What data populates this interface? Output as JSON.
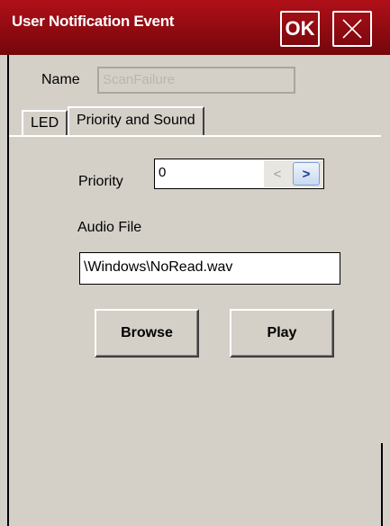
{
  "window": {
    "title": "User Notification Event",
    "ok_label": "OK"
  },
  "name": {
    "label": "Name",
    "value": "ScanFailure"
  },
  "tabs": [
    {
      "label": "LED"
    },
    {
      "label": "Priority and Sound"
    }
  ],
  "priority": {
    "label": "Priority",
    "value": "0",
    "decrement_glyph": "<",
    "increment_glyph": ">"
  },
  "audio": {
    "label": "Audio File",
    "value": "\\Windows\\NoRead.wav"
  },
  "buttons": {
    "browse_label": "Browse",
    "play_label": "Play"
  },
  "colors": {
    "titlebar": "#8c0a10",
    "background": "#d4d0c8"
  }
}
